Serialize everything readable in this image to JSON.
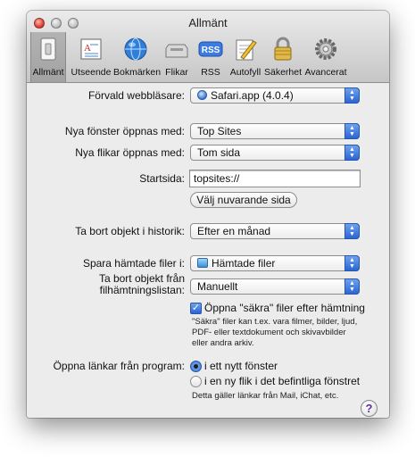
{
  "window": {
    "title": "Allmänt"
  },
  "toolbar": {
    "items": [
      {
        "label": "Allmänt",
        "icon": "switch-icon",
        "selected": true
      },
      {
        "label": "Utseende",
        "icon": "appearance-icon"
      },
      {
        "label": "Bokmärken",
        "icon": "globe-icon"
      },
      {
        "label": "Flikar",
        "icon": "tabs-icon"
      },
      {
        "label": "RSS",
        "icon": "rss-icon"
      },
      {
        "label": "Autofyll",
        "icon": "pencil-icon"
      },
      {
        "label": "Säkerhet",
        "icon": "lock-icon"
      },
      {
        "label": "Avancerat",
        "icon": "gear-icon"
      }
    ]
  },
  "general": {
    "default_browser": {
      "label": "Förvald webbläsare:",
      "value": "Safari.app (4.0.4)"
    },
    "new_windows": {
      "label": "Nya fönster öppnas med:",
      "value": "Top Sites"
    },
    "new_tabs": {
      "label": "Nya flikar öppnas med:",
      "value": "Tom sida"
    },
    "homepage": {
      "label": "Startsida:",
      "value": "topsites://"
    },
    "set_current_button": "Välj nuvarande sida",
    "history": {
      "label": "Ta bort objekt i historik:",
      "value": "Efter en månad"
    },
    "downloads": {
      "label": "Spara hämtade filer i:",
      "value": "Hämtade filer"
    },
    "remove_downloads": {
      "label_line1": "Ta bort objekt från",
      "label_line2": "filhämtningslistan:",
      "value": "Manuellt"
    },
    "safe_files": {
      "label": "Öppna \"säkra\" filer efter hämtning",
      "checked": true,
      "description": [
        "\"Säkra\" filer kan t.ex. vara filmer, bilder, ljud,",
        "PDF- eller textdokument och skivavbilder",
        "eller andra arkiv."
      ]
    },
    "open_links": {
      "label": "Öppna länkar från program:",
      "option1": "i ett nytt fönster",
      "option2": "i en ny flik i det befintliga fönstret",
      "note": "Detta gäller länkar från Mail, iChat, etc.",
      "selected": 1
    },
    "help_glyph": "?"
  },
  "colors": {
    "accent": "#2a66d5",
    "help": "#5b2fa3"
  }
}
